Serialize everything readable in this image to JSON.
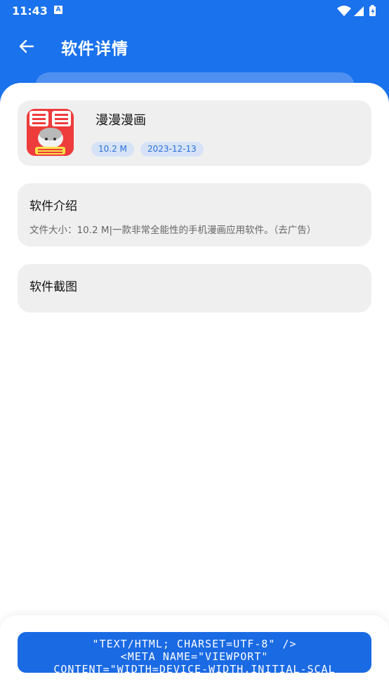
{
  "status": {
    "time": "11:43",
    "notification_icon_letter": "A"
  },
  "header": {
    "title": "软件详情"
  },
  "app": {
    "name": "漫漫漫画",
    "size": "10.2 M",
    "date": "2023-12-13"
  },
  "intro": {
    "title": "软件介绍",
    "text": "文件大小：10.2 M|一款非常全能性的手机漫画应用软件。（去广告）"
  },
  "screenshots": {
    "title": "软件截图"
  },
  "download_button": {
    "line1": "\"TEXT/HTML; CHARSET=UTF-8\" />",
    "line2": "<META NAME=\"VIEWPORT\"",
    "line3": "CONTENT=\"WIDTH=DEVICE-WIDTH,INITIAL-SCAL"
  },
  "colors": {
    "brand": "#1a72ec",
    "card": "#efefef",
    "tag_bg": "#d6e3f7",
    "tag_text": "#2a6fd8",
    "app_icon": "#ee3b3b"
  },
  "icons": [
    "back-arrow-icon",
    "wifi-icon",
    "signal-icon",
    "battery-icon",
    "app-icon"
  ]
}
